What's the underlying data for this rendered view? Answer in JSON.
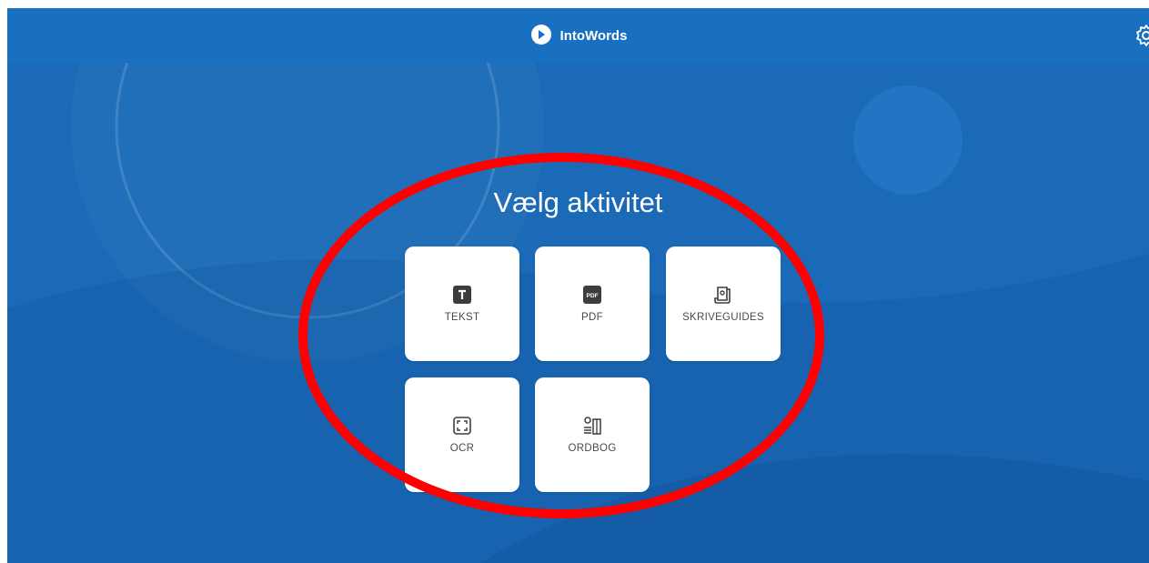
{
  "app": {
    "title": "IntoWords"
  },
  "main": {
    "heading": "Vælg aktivitet",
    "tiles": [
      {
        "label": "TEKST",
        "icon": "text-icon"
      },
      {
        "label": "PDF",
        "icon": "pdf-icon",
        "icon_text": "PDF"
      },
      {
        "label": "SKRIVEGUIDES",
        "icon": "writing-guide-icon"
      },
      {
        "label": "OCR",
        "icon": "ocr-scan-icon"
      },
      {
        "label": "ORDBOG",
        "icon": "dictionary-icon"
      }
    ]
  },
  "colors": {
    "background": "#1a6ab7",
    "topbar": "#1a70c0",
    "tile": "#ffffff",
    "annotation": "#ff0000"
  }
}
